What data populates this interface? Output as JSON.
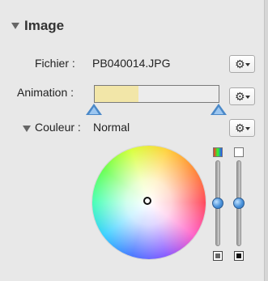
{
  "panel": {
    "section": {
      "title": "Image"
    },
    "fields": {
      "file": {
        "label": "Fichier :",
        "value": "PB040014.JPG"
      },
      "animation": {
        "label": "Animation :",
        "progress": 0.35
      },
      "color": {
        "label": "Couleur :",
        "value": "Normal"
      }
    }
  },
  "icons": {
    "disclosure": "triangle-down",
    "gear": "⚙",
    "gear_menu_caret": "caret-down"
  },
  "colors": {
    "panel_bg": "#e8e8e8",
    "slider_fill": "#f2e6a8",
    "handle_blue": "#4a88c8"
  }
}
